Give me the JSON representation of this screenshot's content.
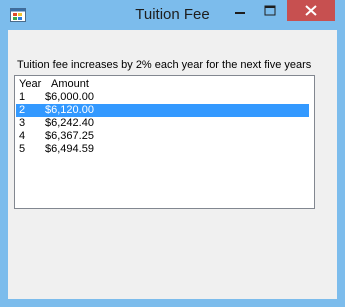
{
  "window": {
    "title": "Tuition Fee",
    "app_icon": "winforms-app-icon",
    "controls": {
      "minimize": "minimize-icon",
      "maximize": "maximize-icon",
      "close": "close-icon"
    }
  },
  "form": {
    "description": "Tuition fee increases by 2% each year for the next five years",
    "list": {
      "columns": [
        "Year",
        "Amount"
      ],
      "rows": [
        {
          "year": "1",
          "amount": "$6,000.00"
        },
        {
          "year": "2",
          "amount": "$6,120.00"
        },
        {
          "year": "3",
          "amount": "$6,242.40"
        },
        {
          "year": "4",
          "amount": "$6,367.25"
        },
        {
          "year": "5",
          "amount": "$6,494.59"
        }
      ],
      "selected_index": 1
    }
  },
  "colors": {
    "selection": "#3399ff",
    "close_button": "#c75050",
    "frame": "#7cbcec"
  }
}
